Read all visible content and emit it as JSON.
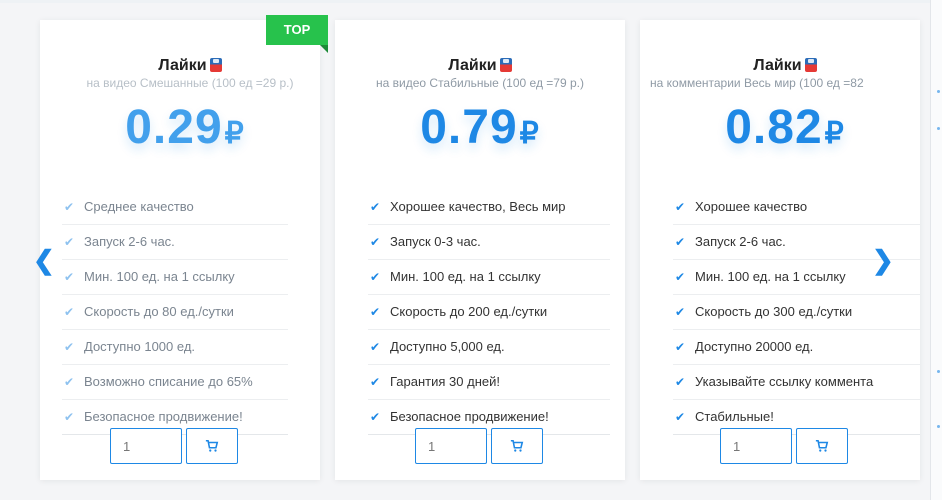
{
  "colors": {
    "accent": "#1e88e5",
    "ribbon": "#27c24c",
    "text": "#333333"
  },
  "ribbon_label": "TOP",
  "carousel": {
    "prev_icon": "❮",
    "next_icon": "❯"
  },
  "cards": [
    {
      "title": "Лайки",
      "platform_icon": "youtube-icon",
      "subtitle": "на видео Смешанные (100 ед =29 р.)",
      "price": "0.29",
      "currency": "₽",
      "features": [
        "Среднее качество",
        "Запуск 2-6 час.",
        "Мин. 100 ед. на 1 ссылку",
        "Скорость до 80 ед./сутки",
        "Доступно 1000 ед.",
        "Возможно списание до 65%",
        "Безопасное продвижение!"
      ],
      "quantity": "1"
    },
    {
      "title": "Лайки",
      "platform_icon": "youtube-icon",
      "subtitle": "на видео Стабильные (100 ед =79 р.)",
      "price": "0.79",
      "currency": "₽",
      "features": [
        "Хорошее качество, Весь мир",
        "Запуск 0-3 час.",
        "Мин. 100 ед. на 1 ссылку",
        "Скорость до 200 ед./сутки",
        "Доступно 5,000 ед.",
        "Гарантия 30 дней!",
        "Безопасное продвижение!"
      ],
      "quantity": "1"
    },
    {
      "title": "Лайки",
      "platform_icon": "youtube-icon",
      "subtitle": "на комментарии Весь мир (100 ед =82",
      "price": "0.82",
      "currency": "₽",
      "features": [
        "Хорошее качество",
        "Запуск 2-6 час.",
        "Мин. 100 ед. на 1 ссылку",
        "Скорость до 300 ед./сутки",
        "Доступно 20000 ед.",
        "Указывайте ссылку коммента",
        "Стабильные!"
      ],
      "quantity": "1"
    }
  ]
}
